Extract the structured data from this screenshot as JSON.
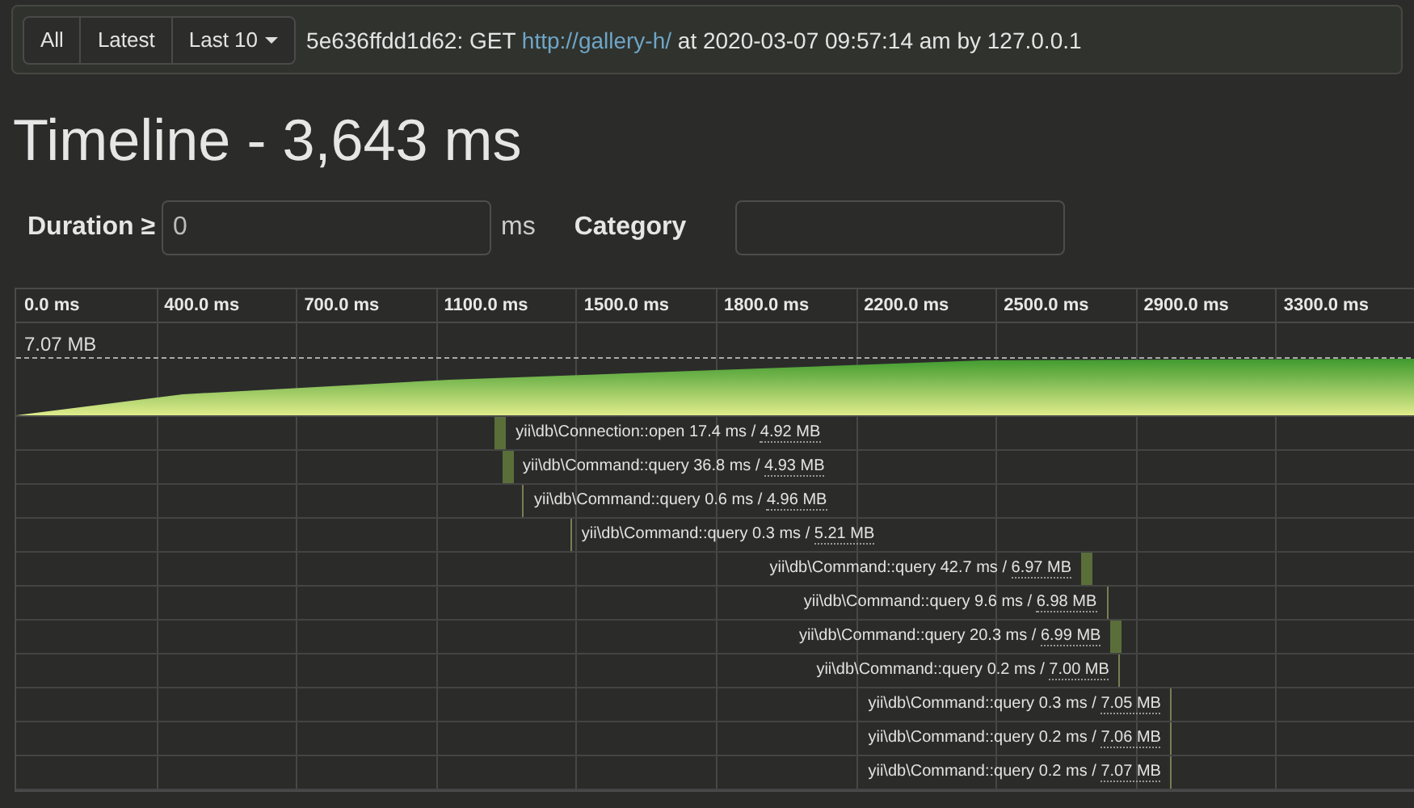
{
  "nav": {
    "buttons": [
      {
        "label": "All"
      },
      {
        "label": "Latest"
      },
      {
        "label": "Last 10",
        "dropdown": true
      }
    ],
    "request": {
      "id": "5e636ffdd1d62:",
      "method": "GET",
      "url": "http://gallery-h/",
      "at_text": "at 2020-03-07 09:57:14 am by 127.0.0.1"
    }
  },
  "title": "Timeline - 3,643 ms",
  "filters": {
    "duration_label": "Duration ≥",
    "duration_value": "0",
    "duration_unit": "ms",
    "category_label": "Category"
  },
  "timeline": {
    "ticks": [
      "0.0 ms",
      "400.0 ms",
      "700.0 ms",
      "1100.0 ms",
      "1500.0 ms",
      "1800.0 ms",
      "2200.0 ms",
      "2500.0 ms",
      "2900.0 ms",
      "3300.0 ms"
    ],
    "memory_peak": "7.07 MB",
    "rows": [
      {
        "name": "yii\\db\\Connection::open",
        "duration": "17.4 ms /",
        "memory": "4.92 MB",
        "level": 0.342,
        "kind": "block"
      },
      {
        "name": "yii\\db\\Command::query",
        "duration": "36.8 ms /",
        "memory": "4.93 MB",
        "level": 0.347,
        "kind": "block"
      },
      {
        "name": "yii\\db\\Command::query",
        "duration": "0.6 ms /",
        "memory": "4.96 MB",
        "level": 0.362,
        "kind": "line"
      },
      {
        "name": "yii\\db\\Command::query",
        "duration": "0.3 ms /",
        "memory": "5.21 MB",
        "level": 0.396,
        "kind": "line"
      },
      {
        "name": "yii\\db\\Command::query",
        "duration": "42.7 ms /",
        "memory": "6.97 MB",
        "level": 0.761,
        "kind": "block"
      },
      {
        "name": "yii\\db\\Command::query",
        "duration": "9.6 ms /",
        "memory": "6.98 MB",
        "level": 0.779,
        "kind": "line"
      },
      {
        "name": "yii\\db\\Command::query",
        "duration": "20.3 ms /",
        "memory": "6.99 MB",
        "level": 0.782,
        "kind": "block"
      },
      {
        "name": "yii\\db\\Command::query",
        "duration": "0.2 ms /",
        "memory": "7.00 MB",
        "level": 0.788,
        "kind": "line"
      },
      {
        "name": "yii\\db\\Command::query",
        "duration": "0.3 ms /",
        "memory": "7.05 MB",
        "level": 0.825,
        "kind": "line"
      },
      {
        "name": "yii\\db\\Command::query",
        "duration": "0.2 ms /",
        "memory": "7.06 MB",
        "level": 0.825,
        "kind": "line"
      },
      {
        "name": "yii\\db\\Command::query",
        "duration": "0.2 ms /",
        "memory": "7.07 MB",
        "level": 0.825,
        "kind": "line"
      }
    ]
  }
}
